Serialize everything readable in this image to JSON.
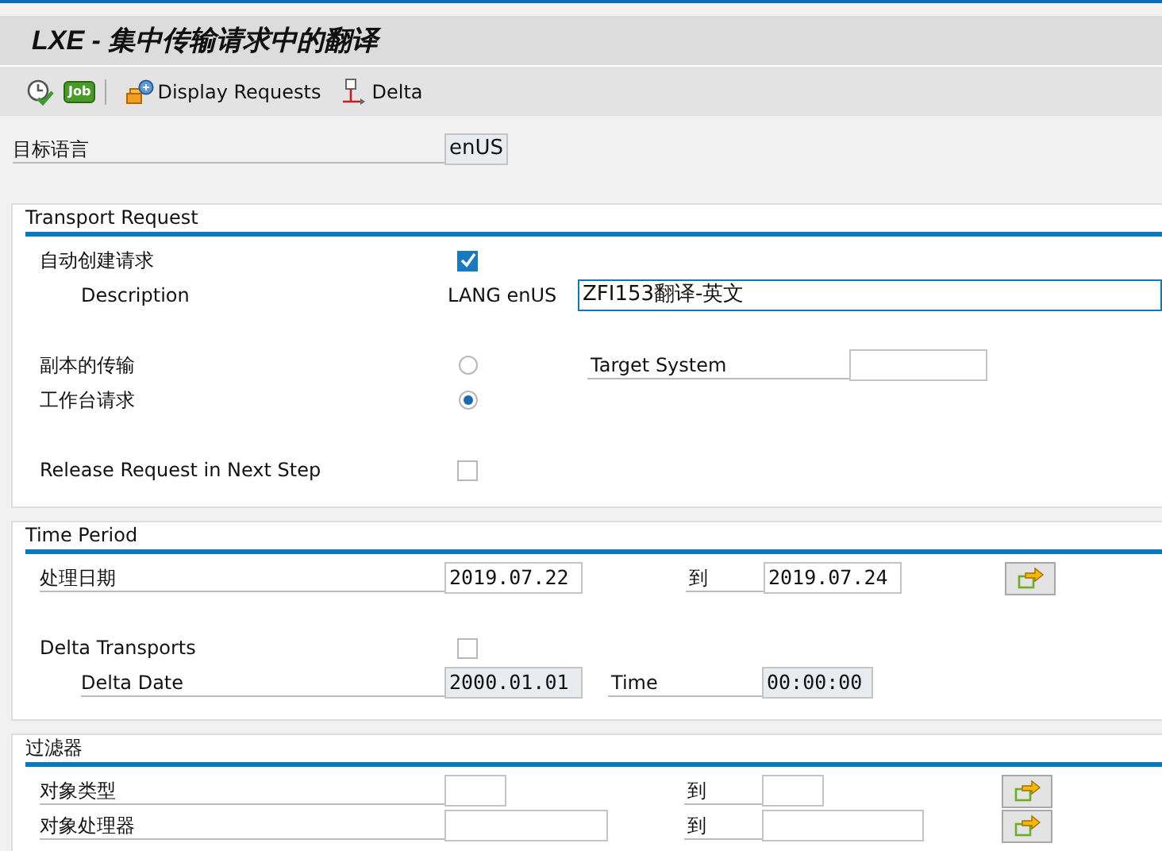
{
  "window": {
    "title": "LXE - 集中传输请求中的翻译"
  },
  "toolbar": [
    {
      "kind": "execute"
    },
    {
      "kind": "job",
      "label": "Job"
    },
    {
      "kind": "separator"
    },
    {
      "kind": "requests",
      "label": "Display Requests"
    },
    {
      "kind": "delta",
      "label": "Delta"
    }
  ],
  "language": {
    "label": "目标语言",
    "value": "enUS"
  },
  "transport_request": {
    "title": "Transport Request",
    "auto_create": {
      "label": "自动创建请求",
      "checked": true
    },
    "description": {
      "label": "Description",
      "prefix": "LANG enUS",
      "value": "ZFI153翻译-英文"
    },
    "options": [
      {
        "label": "副本的传输",
        "selected": false
      },
      {
        "label": "工作台请求",
        "selected": true
      }
    ],
    "target_system": {
      "label": "Target System"
    },
    "release": {
      "label": "Release Request in Next Step",
      "checked": false
    }
  },
  "time_period": {
    "title": "Time Period",
    "date": {
      "label": "处理日期",
      "from": "2019.07.22",
      "to_label": "到",
      "to": "2019.07.24"
    },
    "delta": {
      "label": "Delta Transports",
      "checked": false
    },
    "delta_date": {
      "label": "Delta Date",
      "value": "2000.01.01"
    },
    "time": {
      "label": "Time",
      "value": "00:00:00"
    }
  },
  "filter": {
    "title": "过滤器",
    "rows": [
      {
        "label": "对象类型",
        "to_label": "到",
        "kind": "short"
      },
      {
        "label": "对象处理器",
        "to_label": "到",
        "kind": "long"
      }
    ]
  }
}
